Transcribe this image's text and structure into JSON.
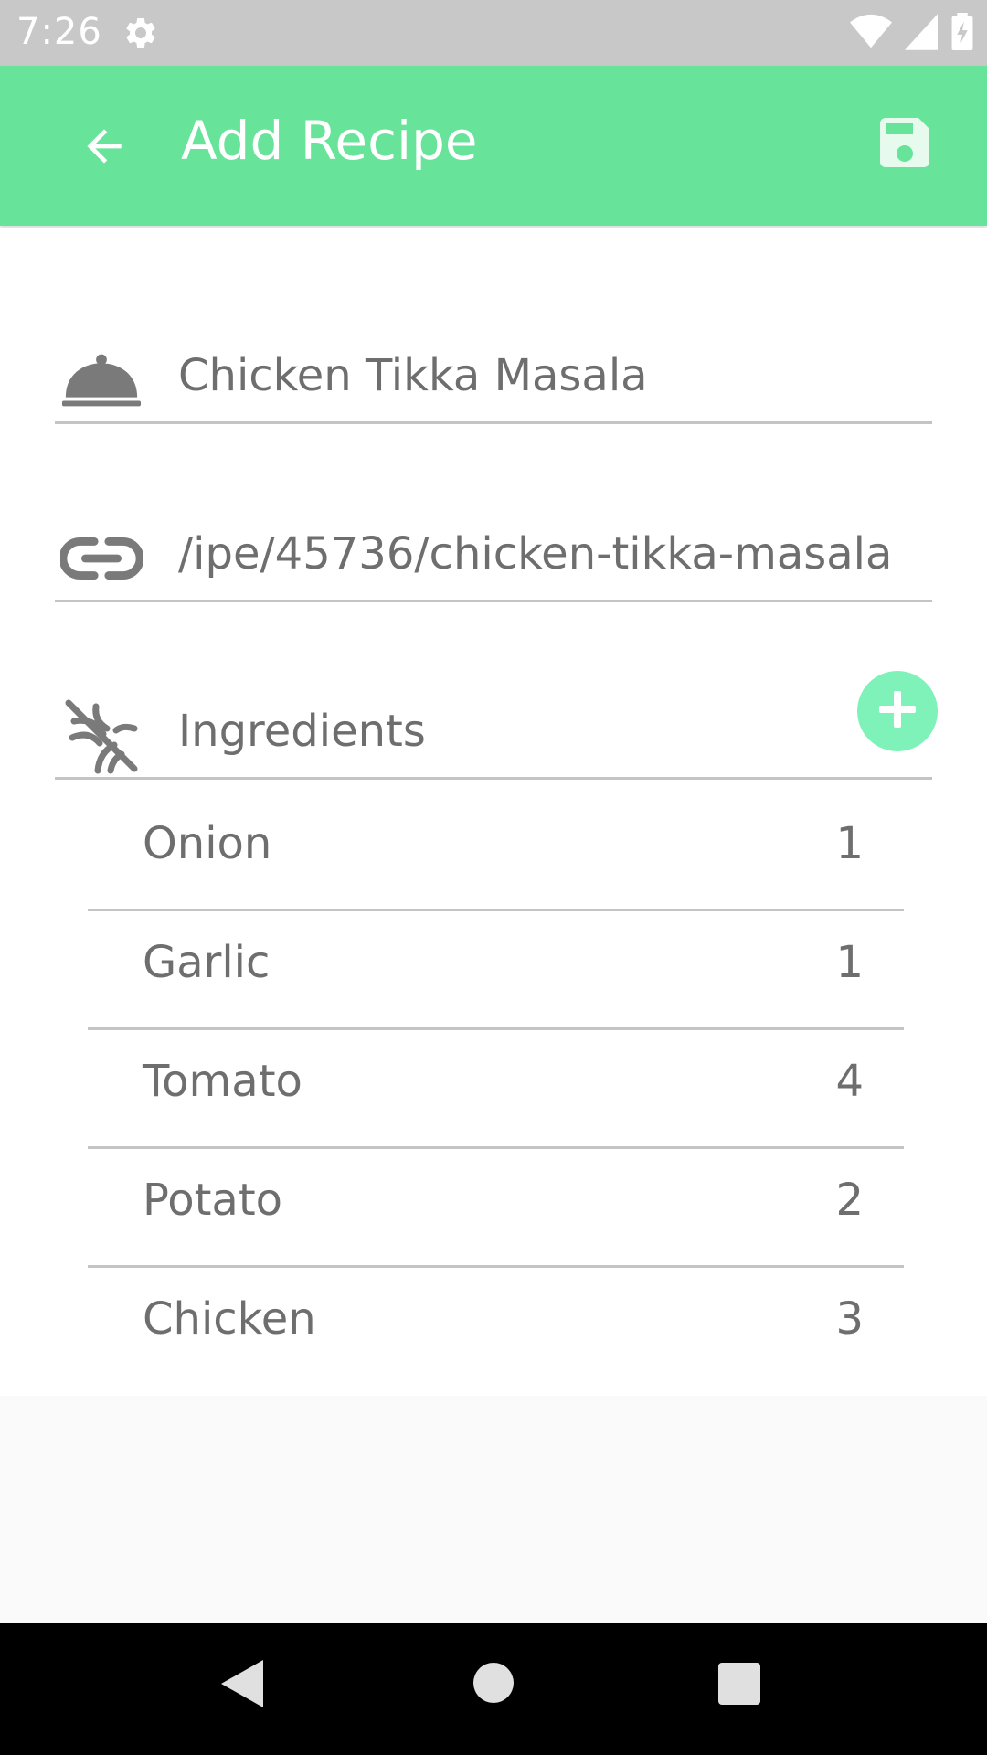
{
  "status_bar": {
    "time": "7:26",
    "icons": [
      "settings-icon",
      "wifi-icon",
      "signal-icon",
      "battery-charging-icon"
    ]
  },
  "app_bar": {
    "title": "Add Recipe",
    "back_icon": "arrow-back-icon",
    "save_icon": "save-icon"
  },
  "form": {
    "name_value": "Chicken Tikka Masala",
    "name_icon": "cloche-icon",
    "url_value": "ipe/45736/chicken-tikka-masala/",
    "url_icon": "link-icon",
    "ingredients_label": "Ingredients",
    "ingredients_icon": "no-food-icon",
    "add_icon": "plus-icon"
  },
  "ingredients": [
    {
      "name": "Onion",
      "qty": "1"
    },
    {
      "name": "Garlic",
      "qty": "1"
    },
    {
      "name": "Tomato",
      "qty": "4"
    },
    {
      "name": "Potato",
      "qty": "2"
    },
    {
      "name": "Chicken",
      "qty": "3"
    }
  ],
  "colors": {
    "accent": "#67e39a",
    "add_button": "#7ef2b8",
    "text": "#6e6e6e",
    "divider": "#c4c4c4"
  }
}
